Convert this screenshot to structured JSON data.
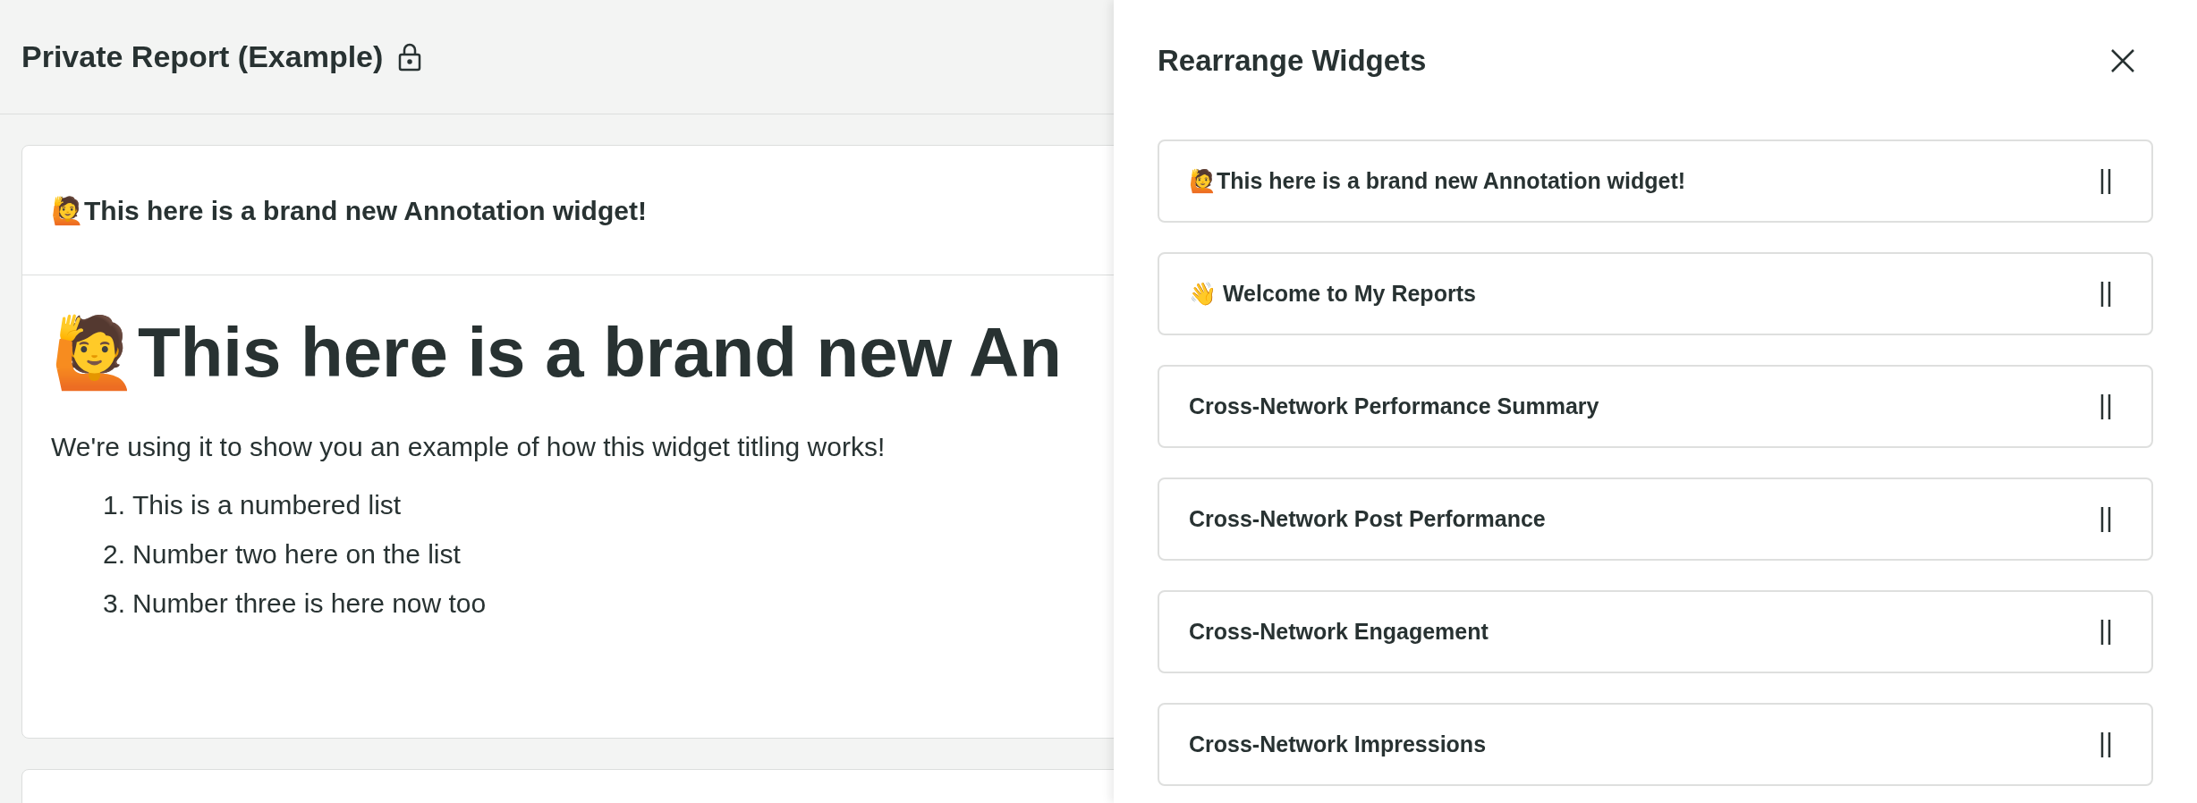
{
  "page": {
    "title": "Private Report (Example)",
    "locked": true
  },
  "card": {
    "title": "🙋This here is a brand new Annotation widget!",
    "heading": "🙋This here is a brand new An",
    "paragraph": "We're using it to show you an example of how this widget titling works!",
    "list": [
      {
        "number": "1.",
        "text": "This is a numbered list"
      },
      {
        "number": "2.",
        "text": "Number two here on the list"
      },
      {
        "number": "3.",
        "text": "Number three is here now too"
      }
    ]
  },
  "panel": {
    "title": "Rearrange Widgets",
    "widgets": [
      {
        "label": "🙋This here is a brand new Annotation widget!"
      },
      {
        "label": "👋 Welcome to My Reports"
      },
      {
        "label": "Cross-Network Performance Summary"
      },
      {
        "label": "Cross-Network Post Performance"
      },
      {
        "label": "Cross-Network Engagement"
      },
      {
        "label": "Cross-Network Impressions"
      }
    ]
  }
}
